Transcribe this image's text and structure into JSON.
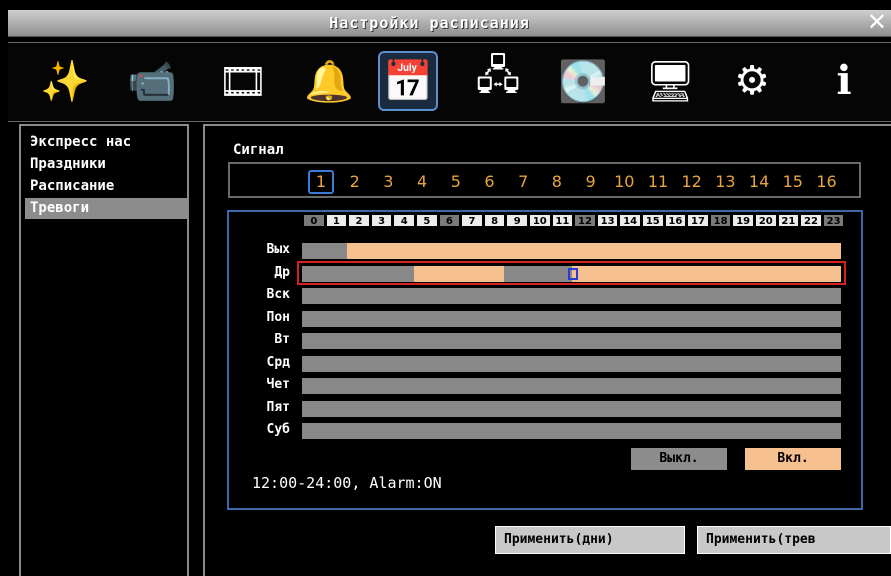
{
  "window": {
    "title": "Настройки расписания",
    "close": "✕"
  },
  "toolbar": {
    "icons": [
      {
        "name": "wizard-wand-icon",
        "glyph": "✨"
      },
      {
        "name": "camera-icon",
        "glyph": "📹"
      },
      {
        "name": "film-reel-icon",
        "glyph": "🎞"
      },
      {
        "name": "bell-icon",
        "glyph": "🔔"
      },
      {
        "name": "schedule-icon",
        "glyph": "📅"
      },
      {
        "name": "network-icon",
        "glyph": "🖧"
      },
      {
        "name": "hard-disk-icon",
        "glyph": "💽"
      },
      {
        "name": "monitor-icon",
        "glyph": "🖥"
      },
      {
        "name": "gears-icon",
        "glyph": "⚙"
      },
      {
        "name": "info-icon",
        "glyph": "ℹ"
      }
    ],
    "active_index": 4
  },
  "sidebar": {
    "items": [
      "Экспресс нас",
      "Праздники",
      "Расписание",
      "Тревоги"
    ],
    "selected_index": 3
  },
  "signal": {
    "label": "Сигнал",
    "channels": [
      "1",
      "2",
      "3",
      "4",
      "5",
      "6",
      "7",
      "8",
      "9",
      "10",
      "11",
      "12",
      "13",
      "14",
      "15",
      "16"
    ],
    "selected": "1"
  },
  "schedule": {
    "hours": [
      "0",
      "1",
      "2",
      "3",
      "4",
      "5",
      "6",
      "7",
      "8",
      "9",
      "10",
      "11",
      "12",
      "13",
      "14",
      "15",
      "16",
      "17",
      "18",
      "19",
      "20",
      "21",
      "22",
      "23"
    ],
    "dark_hours": [
      0,
      6,
      12,
      18,
      23
    ],
    "days": [
      {
        "label": "Вых",
        "on": [
          [
            2,
            24
          ]
        ]
      },
      {
        "label": "Др",
        "on": [
          [
            5,
            9
          ],
          [
            12,
            24
          ]
        ]
      },
      {
        "label": "Вск",
        "on": []
      },
      {
        "label": "Пон",
        "on": []
      },
      {
        "label": "Вт",
        "on": []
      },
      {
        "label": "Срд",
        "on": []
      },
      {
        "label": "Чет",
        "on": []
      },
      {
        "label": "Пят",
        "on": []
      },
      {
        "label": "Суб",
        "on": []
      }
    ],
    "selected_day_index": 1,
    "cursor_hour": 12,
    "off_label": "Выкл.",
    "on_label": "Вкл.",
    "status": "12:00-24:00, Alarm:ON",
    "colors": {
      "on": "#f7c08f",
      "off": "#888888",
      "highlight": "#d82020"
    }
  },
  "footer": {
    "apply_days": "Применить(дни)",
    "apply_alarm": "Применить(трев"
  }
}
